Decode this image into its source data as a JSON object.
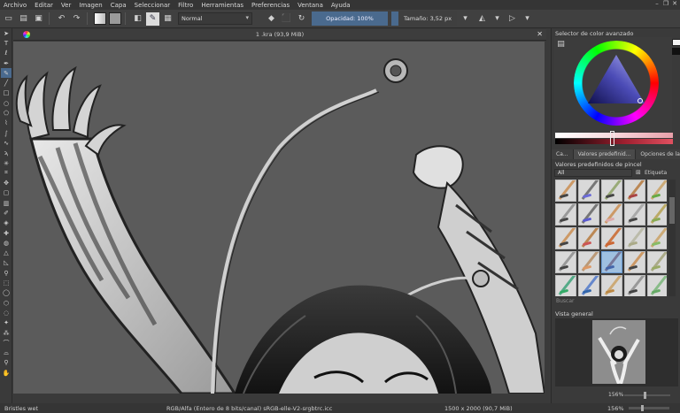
{
  "menu": [
    "Archivo",
    "Editar",
    "Ver",
    "Imagen",
    "Capa",
    "Seleccionar",
    "Filtro",
    "Herramientas",
    "Preferencias",
    "Ventana",
    "Ayuda"
  ],
  "toolbar": {
    "blend_mode": "Normal",
    "opacity_label": "Opacidad:",
    "opacity_value": "100%",
    "size_label": "Tamaño:",
    "size_value": "3,52 px"
  },
  "document": {
    "title": "1 .kra (93,9 MiB)"
  },
  "dock": {
    "color_selector_title": "Selector de color avanzado",
    "tabs": [
      "Ca...",
      "Valores predefinid...",
      "Opciones de la..."
    ],
    "presets_title": "Valores predefinidos de pincel",
    "presets_filter": "All",
    "presets_tag": "Etiqueta",
    "search_placeholder": "Buscar",
    "overview_title": "Vista general",
    "overview_zoom": "156%"
  },
  "status": {
    "brush_name": "Bristles wet",
    "color_info": "RGB/Alfa (Entero de 8 bits/canal)  sRGB-elle-V2-srgbtrc.icc",
    "image_size": "1500 x 2000 (90,7 MiB)",
    "zoom": "156%"
  },
  "colors": {
    "accent": "#4a6a8e",
    "canvas": "#5b5b5b",
    "panel": "#3a3a3a"
  },
  "icons": {
    "tools": [
      "pointer-icon",
      "text-icon",
      "calligraphy-icon",
      "edit-shapes-icon",
      "brush-icon",
      "line-icon",
      "rectangle-icon",
      "ellipse-icon",
      "polygon-icon",
      "polyline-icon",
      "bezier-icon",
      "freehand-path-icon",
      "dynamic-brush-icon",
      "multibrush-icon",
      "crop-icon",
      "move-icon",
      "transform-icon",
      "gradient-icon",
      "color-picker-icon",
      "colorize-mask-icon",
      "smart-patch-icon",
      "fill-icon",
      "assistant-icon",
      "measure-icon",
      "reference-icon",
      "rect-select-icon",
      "ellipse-select-icon",
      "polygon-select-icon",
      "freehand-select-icon",
      "contiguous-select-icon",
      "similar-select-icon",
      "bezier-select-icon",
      "magnetic-select-icon",
      "zoom-icon",
      "pan-icon"
    ]
  }
}
